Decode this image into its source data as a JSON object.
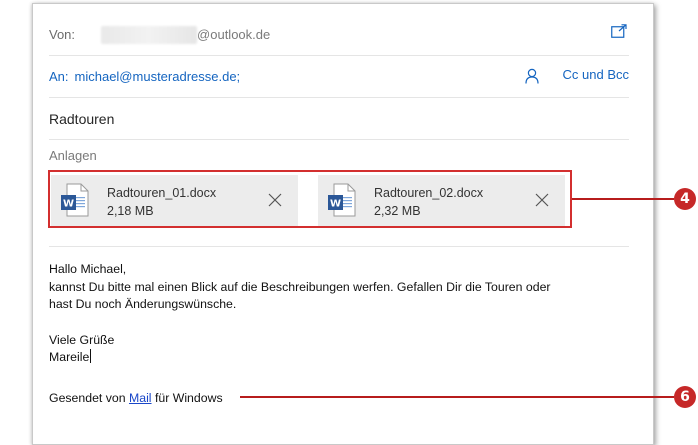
{
  "header": {
    "from_label": "Von:",
    "from_domain": "@outlook.de",
    "popout_icon": "popout-icon",
    "to_label": "An:",
    "to_value": "michael@musteradresse.de;",
    "cc_bcc_label": "Cc und Bcc",
    "subject": "Radtouren"
  },
  "attachments": {
    "label": "Anlagen",
    "items": [
      {
        "name": "Radtouren_01.docx",
        "size": "2,18 MB",
        "icon": "word-doc-icon"
      },
      {
        "name": "Radtouren_02.docx",
        "size": "2,32 MB",
        "icon": "word-doc-icon"
      }
    ]
  },
  "body": {
    "greeting": "Hallo Michael,",
    "line1": "kannst Du bitte mal einen Blick auf die Beschreibungen werfen. Gefallen Dir die Touren oder",
    "line2": "hast Du noch Änderungswünsche.",
    "closing": "Viele Grüße",
    "signature": "Mareile",
    "sent_prefix": "Gesendet von ",
    "sent_link": "Mail",
    "sent_suffix": " für Windows"
  },
  "callouts": {
    "attachments_number": "4",
    "signature_number": "6",
    "color": "#c62828"
  },
  "colors": {
    "link_blue": "#1565c0",
    "highlight_red": "#d32f2f",
    "attachment_bg": "#ececec"
  }
}
